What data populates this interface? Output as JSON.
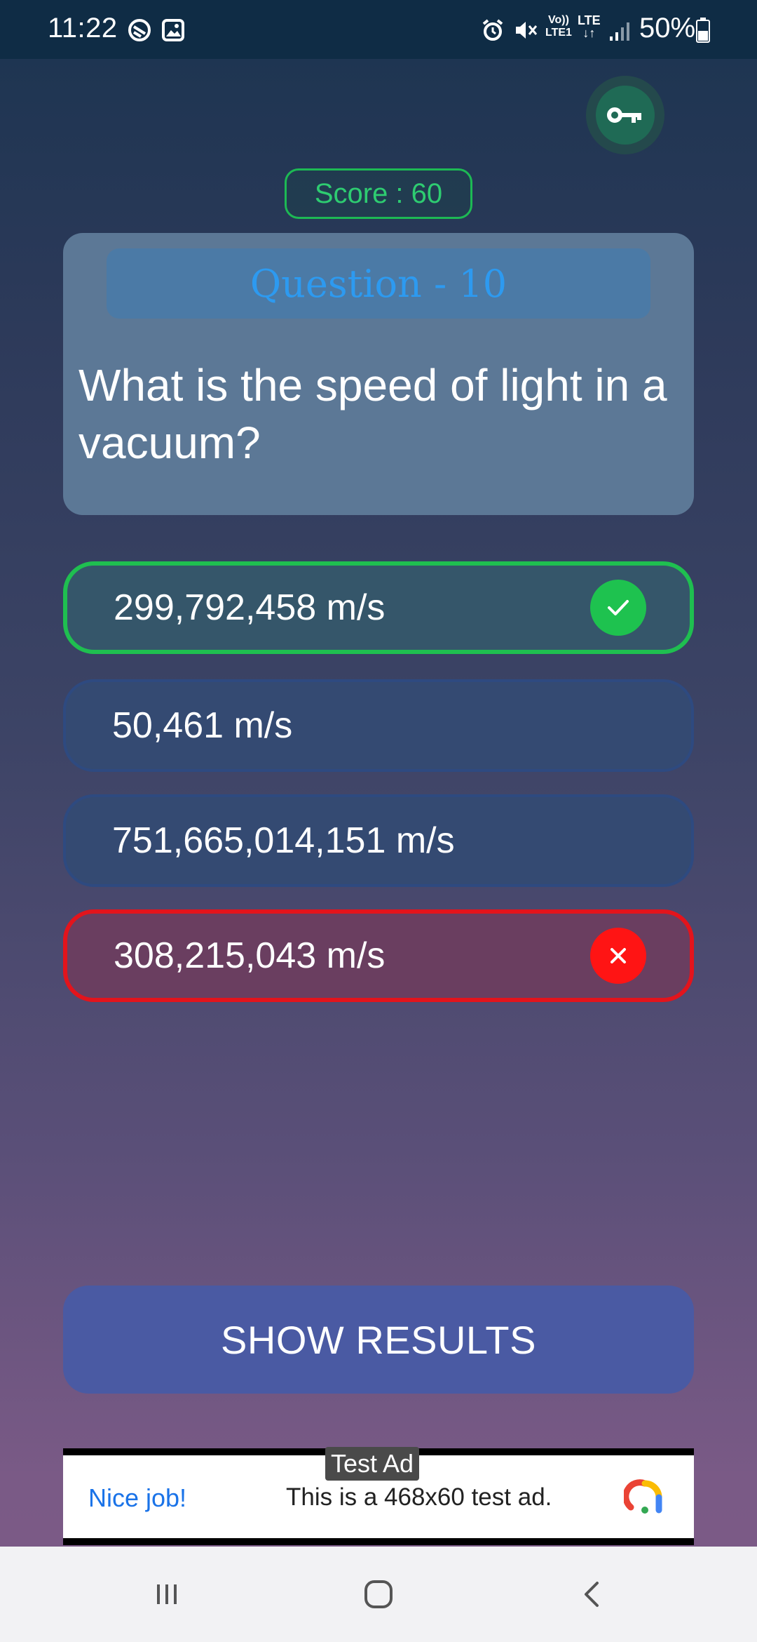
{
  "status_bar": {
    "time": "11:22",
    "volte_top": "Vo))",
    "volte_bottom": "LTE1",
    "network_type": "LTE",
    "battery": "50%"
  },
  "score": {
    "label": "Score : 60"
  },
  "question": {
    "header": "Question - 10",
    "text": "What is the speed of light in a vacuum?"
  },
  "answers": [
    {
      "label": "299,792,458 m/s",
      "state": "correct",
      "icon": "check-icon"
    },
    {
      "label": "50,461 m/s",
      "state": "neutral"
    },
    {
      "label": "751,665,014,151 m/s",
      "state": "neutral"
    },
    {
      "label": "308,215,043 m/s",
      "state": "wrong",
      "icon": "close-icon"
    }
  ],
  "actions": {
    "show_results": "SHOW RESULTS"
  },
  "ad": {
    "badge": "Test Ad",
    "headline": "Nice job!",
    "body": "This is a 468x60 test ad."
  },
  "colors": {
    "correct": "#1ec24f",
    "wrong": "#ff1414",
    "score_accent": "#2ecc71",
    "header_text": "#2d9af0"
  }
}
